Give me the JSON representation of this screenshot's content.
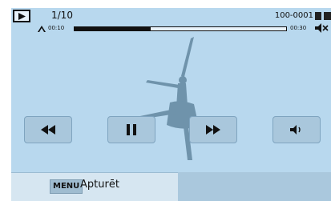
{
  "top_bar": {
    "file_index": "1/10",
    "file_number": "100-0001"
  },
  "progress": {
    "elapsed": "00:10",
    "total": "00:30",
    "fraction": 0.36
  },
  "controls": {
    "rewind_icon": "rewind-icon",
    "pause_icon": "pause-icon",
    "fast_forward_icon": "fast-forward-icon",
    "volume_icon": "volume-icon"
  },
  "bottom_bar": {
    "menu_key": "MENU",
    "stop_label": "Apturēt"
  },
  "colors": {
    "background": "#b8d8ee",
    "button": "#a9c7dc",
    "panel": "#d6e6f1"
  }
}
